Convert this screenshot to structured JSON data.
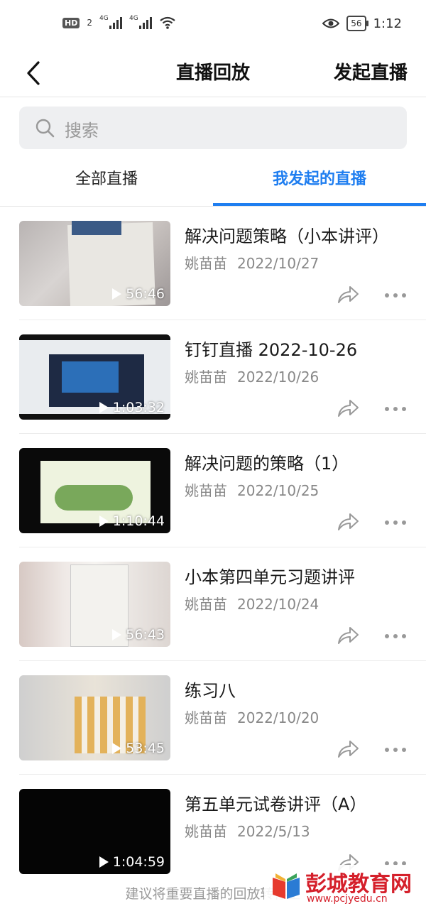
{
  "status_bar": {
    "hd_label": "HD",
    "sim_label": "2",
    "net1": "4G",
    "net2": "4G",
    "battery": "56",
    "time": "1:12"
  },
  "nav": {
    "title": "直播回放",
    "action": "发起直播"
  },
  "search": {
    "placeholder": "搜索"
  },
  "tabs": [
    {
      "label": "全部直播",
      "active": false
    },
    {
      "label": "我发起的直播",
      "active": true
    }
  ],
  "items": [
    {
      "title": "解决问题策略（小本讲评）",
      "author": "姚苗苗",
      "date": "2022/10/27",
      "duration": "56:46"
    },
    {
      "title": "钉钉直播 2022-10-26",
      "author": "姚苗苗",
      "date": "2022/10/26",
      "duration": "1:03:32"
    },
    {
      "title": "解决问题的策略（1）",
      "author": "姚苗苗",
      "date": "2022/10/25",
      "duration": "1:10:44"
    },
    {
      "title": "小本第四单元习题讲评",
      "author": "姚苗苗",
      "date": "2022/10/24",
      "duration": "56:43"
    },
    {
      "title": "练习八",
      "author": "姚苗苗",
      "date": "2022/10/20",
      "duration": "53:45"
    },
    {
      "title": "第五单元试卷讲评（A）",
      "author": "姚苗苗",
      "date": "2022/5/13",
      "duration": "1:04:59"
    }
  ],
  "bottom_note": "建议将重要直播的回放转存至",
  "watermark": {
    "text": "彭城教育网",
    "url": "www.pcjyedu.cn"
  },
  "colors": {
    "accent": "#1f7ef0",
    "watermark": "#d5202b"
  }
}
